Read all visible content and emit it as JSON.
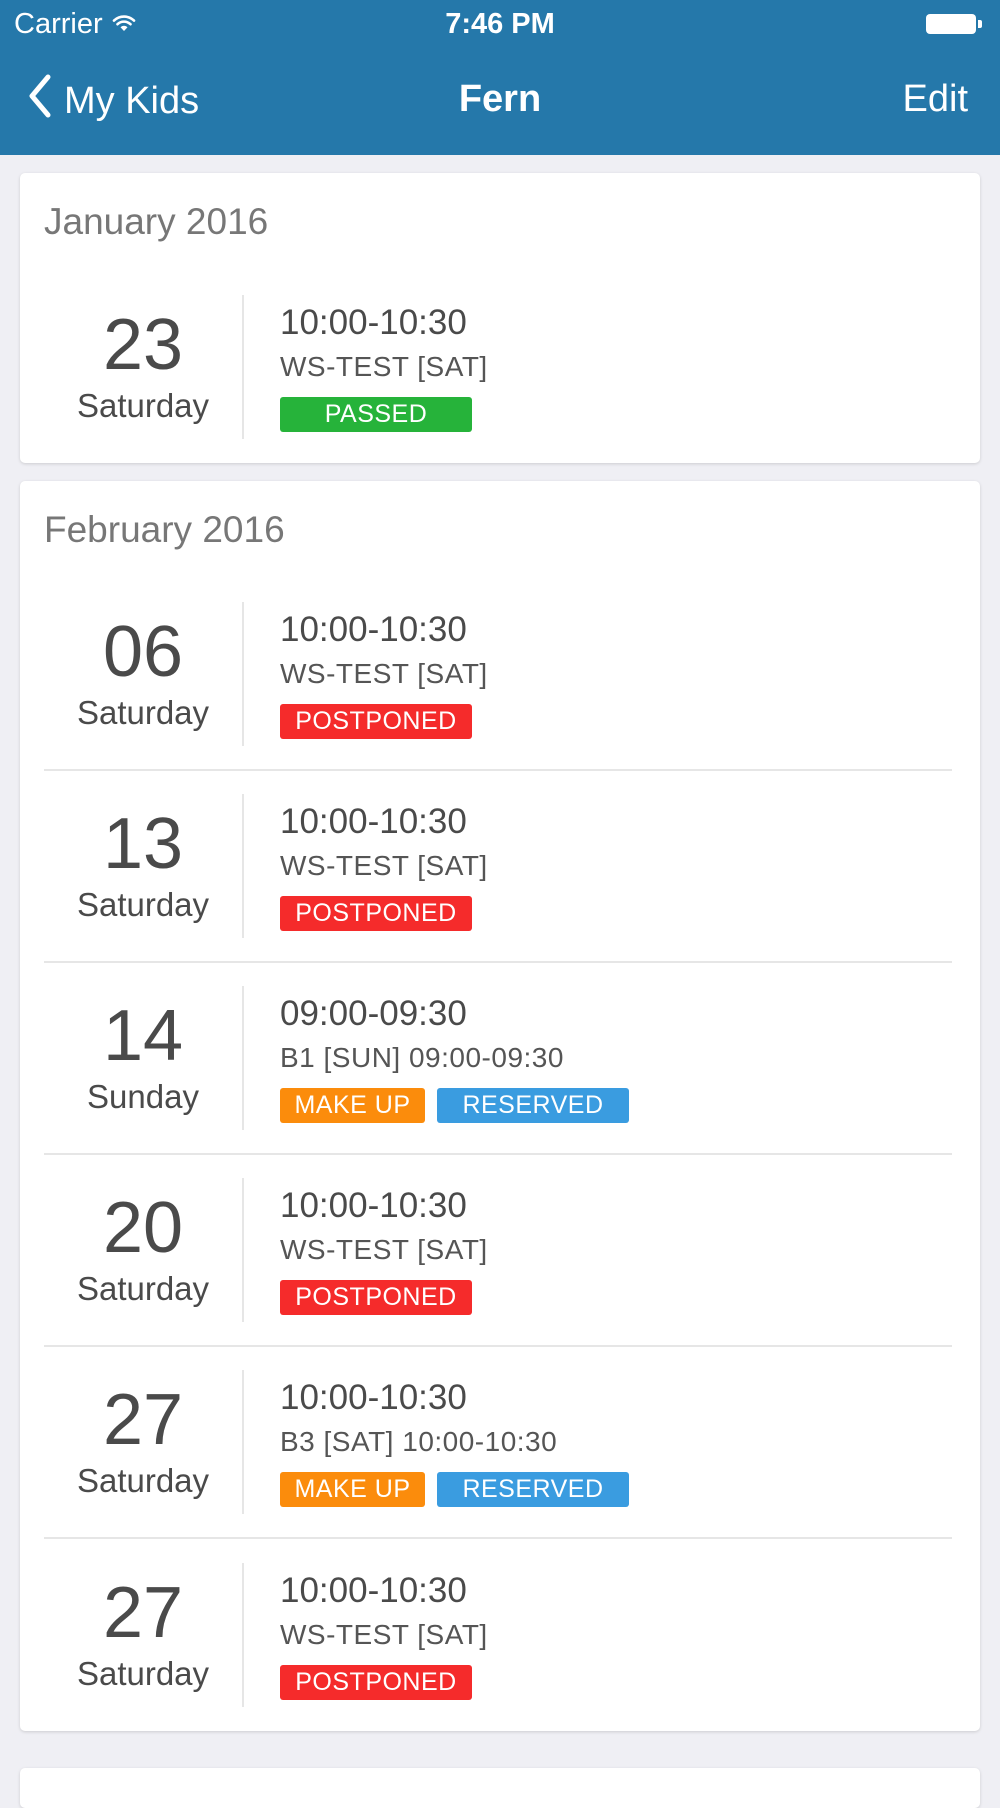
{
  "status_bar": {
    "carrier": "Carrier",
    "time": "7:46 PM"
  },
  "nav": {
    "back_label": "My Kids",
    "title": "Fern",
    "edit_label": "Edit"
  },
  "colors": {
    "header": "#2578aa",
    "passed": "#26b33a",
    "postponed": "#f52b2b",
    "make_up": "#fb8c0c",
    "reserved": "#3a9ce0"
  },
  "months": [
    {
      "title": "January 2016",
      "sessions": [
        {
          "day": "23",
          "weekday": "Saturday",
          "time": "10:00-10:30",
          "class": "WS-TEST [SAT]",
          "badges": [
            {
              "label": "PASSED",
              "type": "passed"
            }
          ]
        }
      ]
    },
    {
      "title": "February 2016",
      "sessions": [
        {
          "day": "06",
          "weekday": "Saturday",
          "time": "10:00-10:30",
          "class": "WS-TEST [SAT]",
          "badges": [
            {
              "label": "POSTPONED",
              "type": "postponed"
            }
          ]
        },
        {
          "day": "13",
          "weekday": "Saturday",
          "time": "10:00-10:30",
          "class": "WS-TEST [SAT]",
          "badges": [
            {
              "label": "POSTPONED",
              "type": "postponed"
            }
          ]
        },
        {
          "day": "14",
          "weekday": "Sunday",
          "time": "09:00-09:30",
          "class": "B1 [SUN] 09:00-09:30",
          "badges": [
            {
              "label": "MAKE UP",
              "type": "makeup"
            },
            {
              "label": "RESERVED",
              "type": "reserved"
            }
          ]
        },
        {
          "day": "20",
          "weekday": "Saturday",
          "time": "10:00-10:30",
          "class": "WS-TEST [SAT]",
          "badges": [
            {
              "label": "POSTPONED",
              "type": "postponed"
            }
          ]
        },
        {
          "day": "27",
          "weekday": "Saturday",
          "time": "10:00-10:30",
          "class": "B3 [SAT] 10:00-10:30",
          "badges": [
            {
              "label": "MAKE UP",
              "type": "makeup"
            },
            {
              "label": "RESERVED",
              "type": "reserved"
            }
          ]
        },
        {
          "day": "27",
          "weekday": "Saturday",
          "time": "10:00-10:30",
          "class": "WS-TEST [SAT]",
          "badges": [
            {
              "label": "POSTPONED",
              "type": "postponed"
            }
          ]
        }
      ]
    }
  ]
}
